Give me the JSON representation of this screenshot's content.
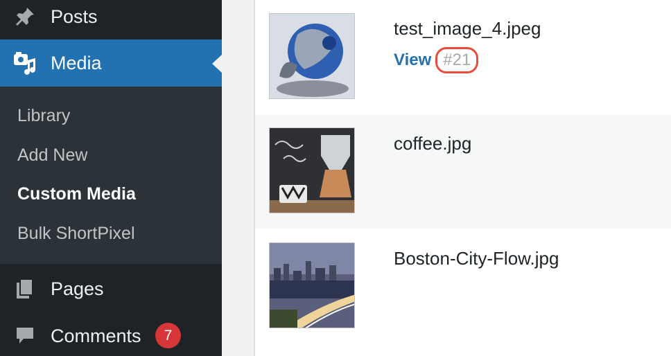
{
  "sidebar": {
    "posts_label": "Posts",
    "media_label": "Media",
    "submenu": {
      "library": "Library",
      "add_new": "Add New",
      "custom_media": "Custom Media",
      "bulk_shortpixel": "Bulk ShortPixel"
    },
    "pages_label": "Pages",
    "comments_label": "Comments",
    "comments_badge": "7"
  },
  "media_list": {
    "rows": [
      {
        "filename": "test_image_4.jpeg",
        "view_label": "View",
        "id_label": "#21"
      },
      {
        "filename": "coffee.jpg"
      },
      {
        "filename": "Boston-City-Flow.jpg"
      }
    ]
  },
  "colors": {
    "sidebar_bg": "#1d2327",
    "active_bg": "#2271b1",
    "badge": "#d63638",
    "highlight_circle": "#e74c3c"
  }
}
